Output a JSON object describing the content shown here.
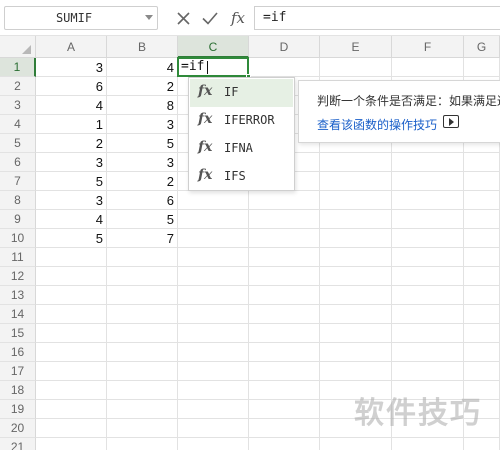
{
  "formula_bar": {
    "name_box": "SUMIF",
    "cancel_icon": "close-icon",
    "confirm_icon": "check-icon",
    "fx_label": "fx",
    "formula": "=if"
  },
  "columns": [
    "A",
    "B",
    "C",
    "D",
    "E",
    "F",
    "G"
  ],
  "active": {
    "column": "C",
    "row": "1",
    "text": "=if"
  },
  "rows": [
    {
      "num": "1",
      "a": "3",
      "b": "4"
    },
    {
      "num": "2",
      "a": "6",
      "b": "2"
    },
    {
      "num": "3",
      "a": "4",
      "b": "8"
    },
    {
      "num": "4",
      "a": "1",
      "b": "3"
    },
    {
      "num": "5",
      "a": "2",
      "b": "5"
    },
    {
      "num": "6",
      "a": "3",
      "b": "3"
    },
    {
      "num": "7",
      "a": "5",
      "b": "2"
    },
    {
      "num": "8",
      "a": "3",
      "b": "6"
    },
    {
      "num": "9",
      "a": "4",
      "b": "5"
    },
    {
      "num": "10",
      "a": "5",
      "b": "7"
    },
    {
      "num": "11",
      "a": "",
      "b": ""
    },
    {
      "num": "12",
      "a": "",
      "b": ""
    },
    {
      "num": "13",
      "a": "",
      "b": ""
    },
    {
      "num": "14",
      "a": "",
      "b": ""
    },
    {
      "num": "15",
      "a": "",
      "b": ""
    },
    {
      "num": "16",
      "a": "",
      "b": ""
    },
    {
      "num": "17",
      "a": "",
      "b": ""
    },
    {
      "num": "18",
      "a": "",
      "b": ""
    },
    {
      "num": "19",
      "a": "",
      "b": ""
    },
    {
      "num": "20",
      "a": "",
      "b": ""
    },
    {
      "num": "21",
      "a": "",
      "b": ""
    }
  ],
  "autocomplete": {
    "fx_label": "fx",
    "items": [
      "IF",
      "IFERROR",
      "IFNA",
      "IFS"
    ],
    "selected": "IF"
  },
  "tip": {
    "description": "判断一个条件是否满足：如果满足返",
    "link": "查看该函数的操作技巧",
    "video_icon": "video-play-icon"
  },
  "watermark": "软件技巧",
  "colors": {
    "accent_green": "#2f8a3a",
    "link_blue": "#1a5fc9",
    "header_bg": "#f3f3f3"
  }
}
